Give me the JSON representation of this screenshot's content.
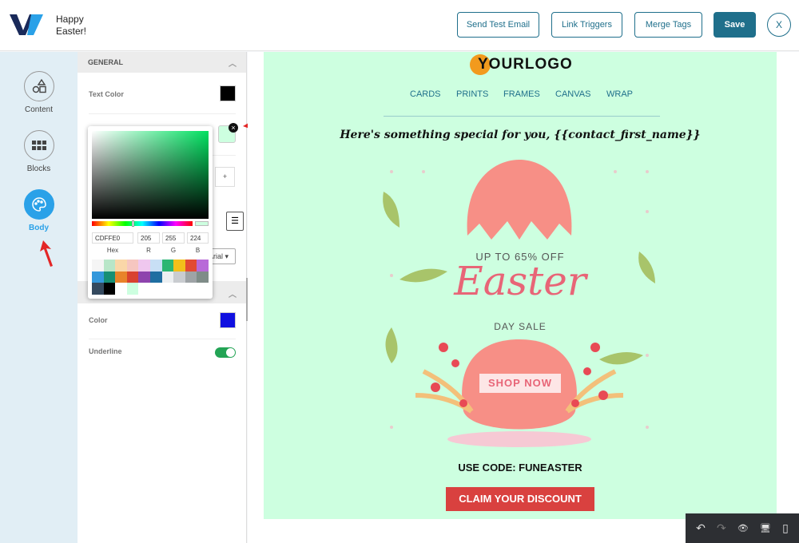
{
  "header": {
    "title": "Happy Easter!",
    "buttons": {
      "send_test": "Send Test Email",
      "link_triggers": "Link Triggers",
      "merge_tags": "Merge Tags",
      "save": "Save",
      "close": "X"
    }
  },
  "sidebar": {
    "items": [
      {
        "label": "Content",
        "icon": "shapes-icon"
      },
      {
        "label": "Blocks",
        "icon": "grid-icon"
      },
      {
        "label": "Body",
        "icon": "palette-icon",
        "active": true
      }
    ]
  },
  "panel": {
    "general_title": "GENERAL",
    "text_color_label": "Text Color",
    "text_color": "#000000",
    "bg_color": "#cdffe0",
    "font_select": "Arial",
    "plus": "+",
    "link_color_label": "Color",
    "link_color": "#1010e0",
    "underline_label": "Underline",
    "underline_on": true
  },
  "picker": {
    "hex": "CDFFE0",
    "r": "205",
    "g": "255",
    "b": "224",
    "hex_label": "Hex",
    "r_label": "R",
    "g_label": "G",
    "b_label": "B",
    "palette": [
      "#f5f5f5",
      "#b8e6c8",
      "#fad7a8",
      "#f6c6c0",
      "#efc7ef",
      "#c8dff5",
      "#2bb673",
      "#f2c01a",
      "#e24a33",
      "#b86ad8",
      "#3498db",
      "#168f74",
      "#e8832a",
      "#d9412f",
      "#8e44ad",
      "#1f6ea1",
      "#eceff1",
      "#c9ccd0",
      "#9ea3a6",
      "#7f8c88",
      "#34495e",
      "#000000",
      "#ffffff",
      "#cdffe0"
    ]
  },
  "email": {
    "logo": "YOURLOGO",
    "menu": [
      "CARDS",
      "PRINTS",
      "FRAMES",
      "CANVAS",
      "WRAP"
    ],
    "headline": "Here's something special for you, {{contact_first_name}}",
    "promo_top": "UP TO 65% OFF",
    "promo_main": "Easter",
    "promo_sub": "DAY SALE",
    "shop_now": "SHOP NOW",
    "code": "USE CODE: FUNEASTER",
    "cta": "CLAIM YOUR DISCOUNT",
    "bg": "#cdffe0",
    "cta_color": "#d9413f"
  },
  "toolbar": {
    "undo": "↶",
    "redo": "↷",
    "preview": "👁",
    "desktop": "🖥",
    "mobile": "▯"
  }
}
